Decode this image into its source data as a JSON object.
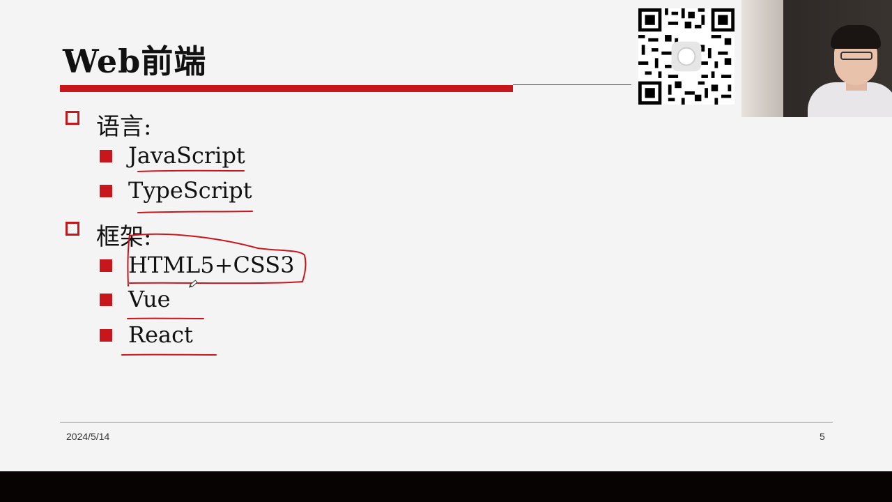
{
  "slide": {
    "title": "Web前端",
    "sections": [
      {
        "heading": "语言:",
        "items": [
          "JavaScript",
          "TypeScript"
        ]
      },
      {
        "heading": "框架:",
        "items": [
          "HTML5+CSS3",
          "Vue",
          "React"
        ]
      }
    ],
    "footer": {
      "date": "2024/5/14",
      "page": "5"
    }
  },
  "colors": {
    "accent": "#c8161d",
    "background": "#f4f4f4",
    "bottom_bar": "#070303"
  },
  "icons": {
    "level1_bullet": "hollow-square-icon",
    "level2_bullet": "solid-square-icon",
    "cursor": "pen-cursor-icon"
  }
}
